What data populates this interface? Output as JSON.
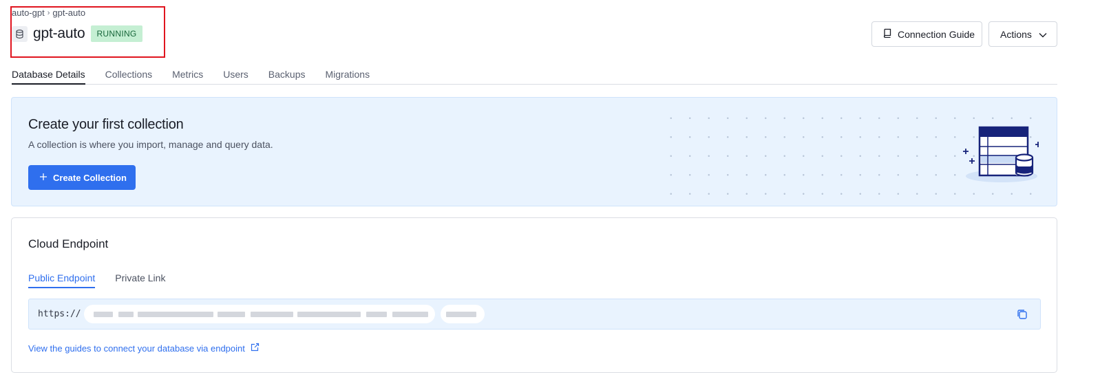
{
  "breadcrumb": {
    "parent": "auto-gpt",
    "separator": "›",
    "current": "gpt-auto"
  },
  "header": {
    "title": "gpt-auto",
    "status": "RUNNING",
    "connection_guide_label": "Connection Guide",
    "actions_label": "Actions"
  },
  "tabs": [
    {
      "label": "Database Details",
      "active": true
    },
    {
      "label": "Collections"
    },
    {
      "label": "Metrics"
    },
    {
      "label": "Users"
    },
    {
      "label": "Backups"
    },
    {
      "label": "Migrations"
    }
  ],
  "banner": {
    "title": "Create your first collection",
    "description": "A collection is where you import, manage and query data.",
    "create_button_label": "Create Collection"
  },
  "cloud_endpoint": {
    "title": "Cloud Endpoint",
    "tabs": [
      {
        "label": "Public Endpoint",
        "active": true
      },
      {
        "label": "Private Link"
      }
    ],
    "url_prefix": "https://",
    "guide_link": "View the guides to connect your database via endpoint"
  },
  "colors": {
    "accent": "#2f6fee",
    "status_bg": "#c5efd3",
    "status_text": "#17663a",
    "banner_bg": "#e9f3fe",
    "illustration_navy": "#17237a"
  },
  "icons": [
    "database-icon",
    "book-icon",
    "chevron-down-icon",
    "plus-icon",
    "copy-icon",
    "external-link-icon"
  ]
}
